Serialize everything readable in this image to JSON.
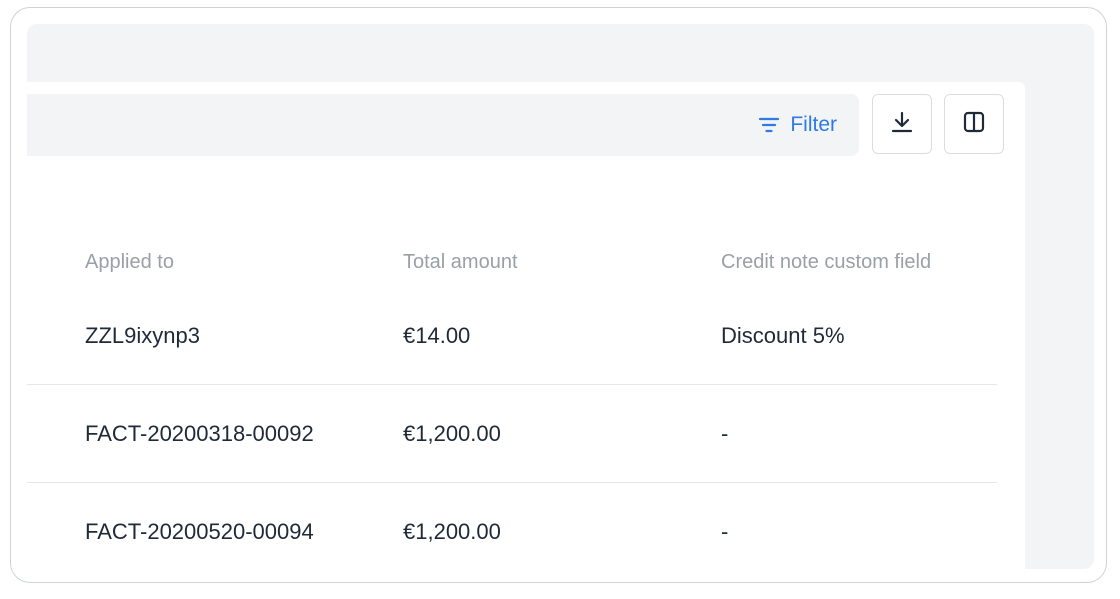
{
  "toolbar": {
    "filter_label": "Filter",
    "filter_icon": "filter-lines-icon",
    "download_icon": "download-icon",
    "columns_icon": "columns-icon",
    "accent_color": "#2e7ae6"
  },
  "table": {
    "columns": [
      "Applied to",
      "Total amount",
      "Credit note custom field"
    ],
    "rows": [
      {
        "applied_to": "ZZL9ixynp3",
        "total_amount": "€14.00",
        "custom_field": "Discount 5%"
      },
      {
        "applied_to": "FACT-20200318-00092",
        "total_amount": "€1,200.00",
        "custom_field": "-"
      },
      {
        "applied_to": "FACT-20200520-00094",
        "total_amount": "€1,200.00",
        "custom_field": "-"
      }
    ]
  }
}
